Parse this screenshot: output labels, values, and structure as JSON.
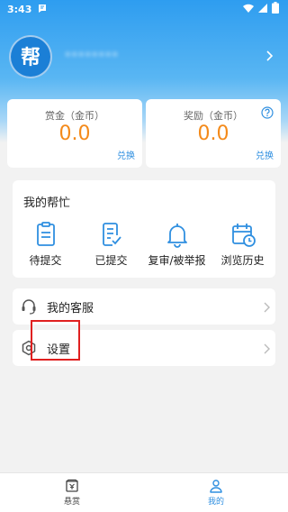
{
  "status_bar": {
    "time": "3:43"
  },
  "profile": {
    "logo_text": "帮",
    "username": "********"
  },
  "rewards": [
    {
      "label": "赏金（金币）",
      "value": "0.0",
      "action": "兑换"
    },
    {
      "label": "奖励（金币）",
      "value": "0.0",
      "action": "兑换"
    }
  ],
  "help_section": {
    "title": "我的帮忙",
    "items": [
      {
        "label": "待提交",
        "icon": "clipboard-icon"
      },
      {
        "label": "已提交",
        "icon": "clipboard-check-icon"
      },
      {
        "label": "复审/被举报",
        "icon": "bell-icon"
      },
      {
        "label": "浏览历史",
        "icon": "calendar-clock-icon"
      }
    ]
  },
  "menu": {
    "service_label": "我的客服",
    "settings_label": "设置"
  },
  "tabbar": {
    "tabs": [
      {
        "label": "悬赏",
        "icon": "bounty-icon"
      },
      {
        "label": "我的",
        "icon": "person-icon"
      }
    ],
    "active_index": 1
  },
  "colors": {
    "primary_blue": "#2e9df0",
    "accent_orange": "#f48a1a",
    "link_blue": "#2f8fe0",
    "highlight_red": "#e02020"
  }
}
